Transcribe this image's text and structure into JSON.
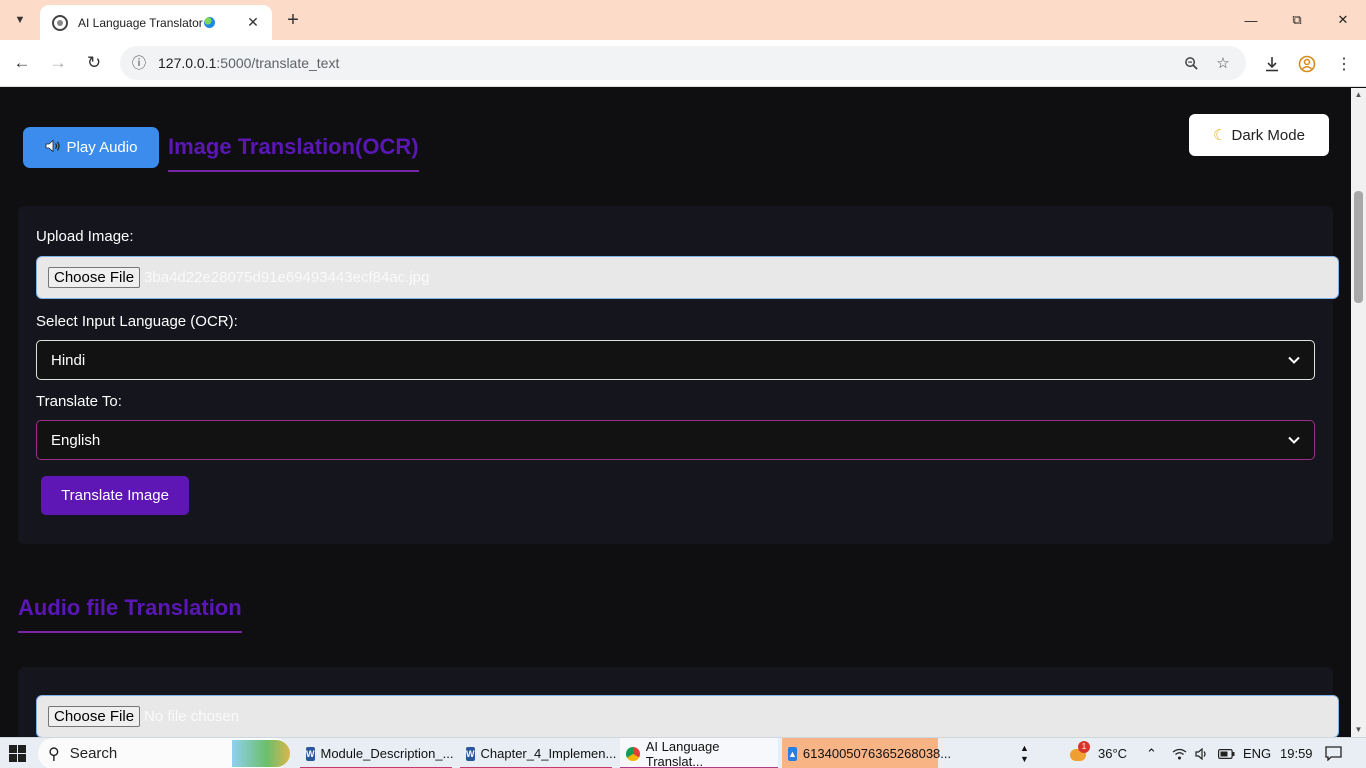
{
  "browser": {
    "tab_title": "AI Language Translator",
    "url_host": "127.0.0.1",
    "url_path": ":5000/translate_text"
  },
  "page": {
    "play_audio_label": "Play Audio",
    "image_section_title": "Image Translation(OCR)",
    "dark_mode_label": "Dark Mode",
    "upload_image_label": "Upload Image:",
    "choose_file_label": "Choose File",
    "image_file_name": "3ba4d22e28075d91e69493443ecf84ac.jpg",
    "input_language_label": "Select Input Language (OCR):",
    "input_language_value": "Hindi",
    "translate_to_label": "Translate To:",
    "translate_to_value": "English",
    "translate_image_label": "Translate Image",
    "audio_section_title": "Audio file Translation",
    "audio_choose_file_label": "Choose File",
    "audio_file_status": "No file chosen"
  },
  "taskbar": {
    "search_placeholder": "Search",
    "apps": [
      {
        "label": "Module_Description_...",
        "icon": "word-icon"
      },
      {
        "label": "Chapter_4_Implemen...",
        "icon": "word-icon"
      },
      {
        "label": "AI Language Translat...",
        "icon": "chrome-icon"
      },
      {
        "label": "6134005076365268038...",
        "icon": "photos-icon"
      }
    ],
    "weather_badge": "1",
    "temperature": "36°C",
    "language": "ENG",
    "time": "19:59"
  },
  "colors": {
    "accent_purple": "#5b16b6",
    "play_blue": "#3b8ced",
    "translate_purple": "#5e16b5",
    "page_bg": "#0f0f12",
    "tab_strip": "#fcdcc8"
  }
}
